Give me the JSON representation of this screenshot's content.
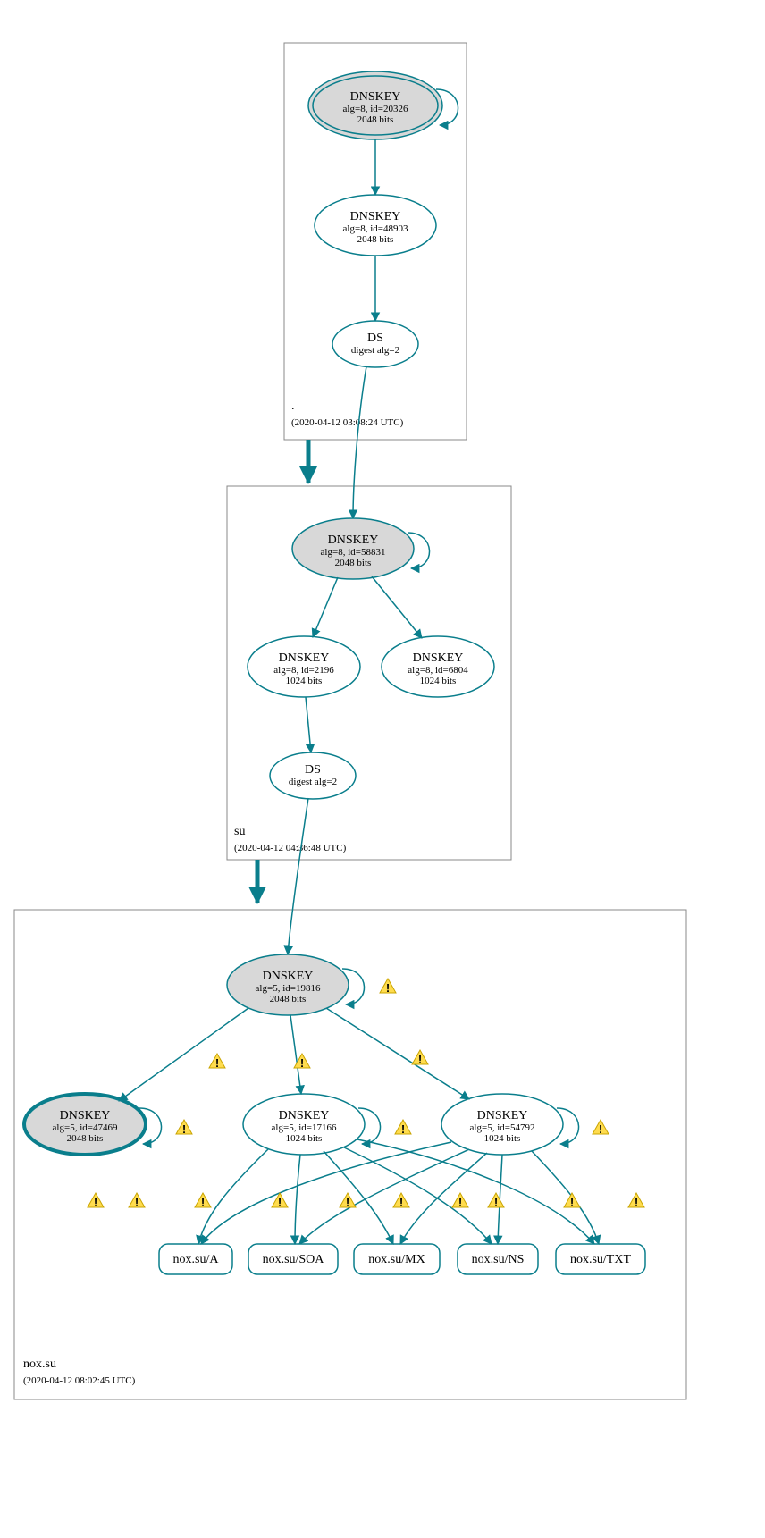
{
  "colors": {
    "stroke": "#0a7e8c",
    "node_fill_grey": "#d8d8d8",
    "warn_fill": "#ffdc4e",
    "warn_stroke": "#c9a400"
  },
  "zones": {
    "root": {
      "label": ".",
      "time": "(2020-04-12 03:08:24 UTC)"
    },
    "su": {
      "label": "su",
      "time": "(2020-04-12 04:36:48 UTC)"
    },
    "noxsu": {
      "label": "nox.su",
      "time": "(2020-04-12 08:02:45 UTC)"
    }
  },
  "nodes": {
    "root_ksk": {
      "l1": "DNSKEY",
      "l2": "alg=8, id=20326",
      "l3": "2048 bits"
    },
    "root_zsk": {
      "l1": "DNSKEY",
      "l2": "alg=8, id=48903",
      "l3": "2048 bits"
    },
    "root_ds": {
      "l1": "DS",
      "l2": "digest alg=2"
    },
    "su_ksk": {
      "l1": "DNSKEY",
      "l2": "alg=8, id=58831",
      "l3": "2048 bits"
    },
    "su_zsk1": {
      "l1": "DNSKEY",
      "l2": "alg=8, id=2196",
      "l3": "1024 bits"
    },
    "su_zsk2": {
      "l1": "DNSKEY",
      "l2": "alg=8, id=6804",
      "l3": "1024 bits"
    },
    "su_ds": {
      "l1": "DS",
      "l2": "digest alg=2"
    },
    "nox_ksk": {
      "l1": "DNSKEY",
      "l2": "alg=5, id=19816",
      "l3": "2048 bits"
    },
    "nox_47469": {
      "l1": "DNSKEY",
      "l2": "alg=5, id=47469",
      "l3": "2048 bits"
    },
    "nox_17166": {
      "l1": "DNSKEY",
      "l2": "alg=5, id=17166",
      "l3": "1024 bits"
    },
    "nox_54792": {
      "l1": "DNSKEY",
      "l2": "alg=5, id=54792",
      "l3": "1024 bits"
    }
  },
  "rrsets": {
    "a": "nox.su/A",
    "soa": "nox.su/SOA",
    "mx": "nox.su/MX",
    "ns": "nox.su/NS",
    "txt": "nox.su/TXT"
  },
  "chart_data": {
    "type": "graph",
    "description": "DNSSEC authentication chain / DNSViz-style delegation graph",
    "zones": [
      {
        "name": ".",
        "analyzed_at": "2020-04-12 03:08:24 UTC"
      },
      {
        "name": "su",
        "analyzed_at": "2020-04-12 04:36:48 UTC"
      },
      {
        "name": "nox.su",
        "analyzed_at": "2020-04-12 08:02:45 UTC"
      }
    ],
    "nodes": [
      {
        "id": "root_ksk",
        "zone": ".",
        "type": "DNSKEY",
        "alg": 8,
        "key_id": 20326,
        "bits": 2048,
        "role": "KSK_trust_anchor",
        "self_loop": true,
        "warning": false
      },
      {
        "id": "root_zsk",
        "zone": ".",
        "type": "DNSKEY",
        "alg": 8,
        "key_id": 48903,
        "bits": 2048,
        "self_loop": false,
        "warning": false
      },
      {
        "id": "root_ds",
        "zone": ".",
        "type": "DS",
        "digest_alg": 2
      },
      {
        "id": "su_ksk",
        "zone": "su",
        "type": "DNSKEY",
        "alg": 8,
        "key_id": 58831,
        "bits": 2048,
        "role": "KSK",
        "self_loop": true,
        "warning": false
      },
      {
        "id": "su_zsk1",
        "zone": "su",
        "type": "DNSKEY",
        "alg": 8,
        "key_id": 2196,
        "bits": 1024,
        "self_loop": false,
        "warning": false
      },
      {
        "id": "su_zsk2",
        "zone": "su",
        "type": "DNSKEY",
        "alg": 8,
        "key_id": 6804,
        "bits": 1024,
        "self_loop": false,
        "warning": false
      },
      {
        "id": "su_ds",
        "zone": "su",
        "type": "DS",
        "digest_alg": 2
      },
      {
        "id": "nox_ksk",
        "zone": "nox.su",
        "type": "DNSKEY",
        "alg": 5,
        "key_id": 19816,
        "bits": 2048,
        "role": "KSK",
        "self_loop": true,
        "warning": true
      },
      {
        "id": "nox_47469",
        "zone": "nox.su",
        "type": "DNSKEY",
        "alg": 5,
        "key_id": 47469,
        "bits": 2048,
        "self_loop": true,
        "warning": true
      },
      {
        "id": "nox_17166",
        "zone": "nox.su",
        "type": "DNSKEY",
        "alg": 5,
        "key_id": 17166,
        "bits": 1024,
        "self_loop": true,
        "warning": true
      },
      {
        "id": "nox_54792",
        "zone": "nox.su",
        "type": "DNSKEY",
        "alg": 5,
        "key_id": 54792,
        "bits": 1024,
        "self_loop": true,
        "warning": true
      },
      {
        "id": "rr_a",
        "zone": "nox.su",
        "type": "RRset",
        "name": "nox.su/A"
      },
      {
        "id": "rr_soa",
        "zone": "nox.su",
        "type": "RRset",
        "name": "nox.su/SOA"
      },
      {
        "id": "rr_mx",
        "zone": "nox.su",
        "type": "RRset",
        "name": "nox.su/MX"
      },
      {
        "id": "rr_ns",
        "zone": "nox.su",
        "type": "RRset",
        "name": "nox.su/NS"
      },
      {
        "id": "rr_txt",
        "zone": "nox.su",
        "type": "RRset",
        "name": "nox.su/TXT"
      }
    ],
    "edges": [
      {
        "from": "root_ksk",
        "to": "root_zsk",
        "warning": false
      },
      {
        "from": "root_zsk",
        "to": "root_ds",
        "warning": false
      },
      {
        "from": "root_ds",
        "to": "su_ksk",
        "warning": false
      },
      {
        "from": "su_ksk",
        "to": "su_zsk1",
        "warning": false
      },
      {
        "from": "su_ksk",
        "to": "su_zsk2",
        "warning": false
      },
      {
        "from": "su_zsk1",
        "to": "su_ds",
        "warning": false
      },
      {
        "from": "su_ds",
        "to": "nox_ksk",
        "warning": false
      },
      {
        "from": "nox_ksk",
        "to": "nox_47469",
        "warning": true
      },
      {
        "from": "nox_ksk",
        "to": "nox_17166",
        "warning": true
      },
      {
        "from": "nox_ksk",
        "to": "nox_54792",
        "warning": true
      },
      {
        "from": "nox_17166",
        "to": "rr_a",
        "warning": true
      },
      {
        "from": "nox_17166",
        "to": "rr_soa",
        "warning": true
      },
      {
        "from": "nox_17166",
        "to": "rr_mx",
        "warning": true
      },
      {
        "from": "nox_17166",
        "to": "rr_ns",
        "warning": true
      },
      {
        "from": "nox_17166",
        "to": "rr_txt",
        "warning": true
      },
      {
        "from": "nox_54792",
        "to": "rr_a",
        "warning": true
      },
      {
        "from": "nox_54792",
        "to": "rr_soa",
        "warning": true
      },
      {
        "from": "nox_54792",
        "to": "rr_mx",
        "warning": true
      },
      {
        "from": "nox_54792",
        "to": "rr_ns",
        "warning": true
      },
      {
        "from": "nox_54792",
        "to": "rr_txt",
        "warning": true
      }
    ],
    "zone_delegations": [
      {
        "from": ".",
        "to": "su",
        "secure": true
      },
      {
        "from": "su",
        "to": "nox.su",
        "secure": true
      }
    ]
  }
}
